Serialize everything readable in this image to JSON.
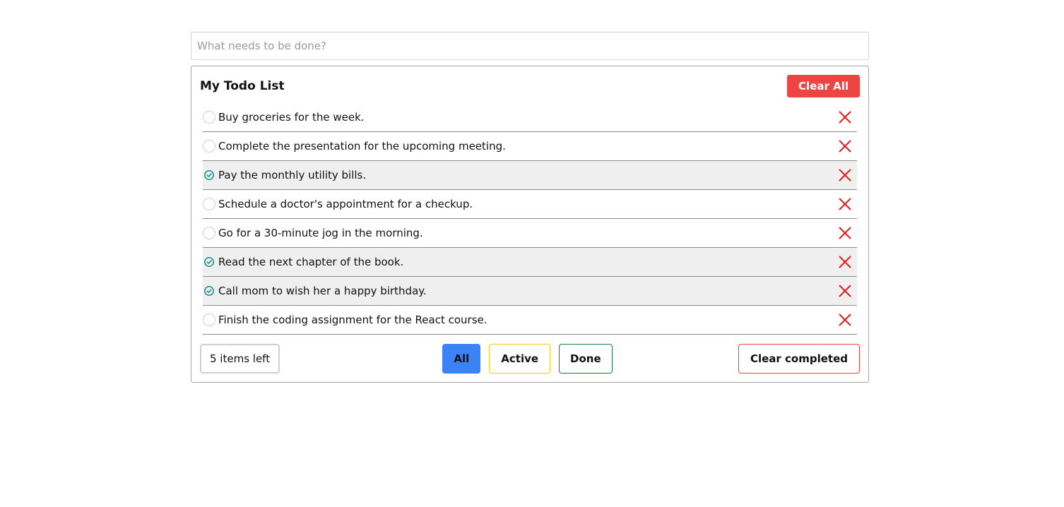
{
  "input": {
    "placeholder": "What needs to be done?",
    "value": ""
  },
  "header": {
    "title": "My Todo List",
    "clear_all_label": "Clear All"
  },
  "todos": [
    {
      "text": "Buy groceries for the week.",
      "done": false
    },
    {
      "text": "Complete the presentation for the upcoming meeting.",
      "done": false
    },
    {
      "text": "Pay the monthly utility bills.",
      "done": true
    },
    {
      "text": "Schedule a doctor's appointment for a checkup.",
      "done": false
    },
    {
      "text": "Go for a 30-minute jog in the morning.",
      "done": false
    },
    {
      "text": "Read the next chapter of the book.",
      "done": true
    },
    {
      "text": "Call mom to wish her a happy birthday.",
      "done": true
    },
    {
      "text": "Finish the coding assignment for the React course.",
      "done": false
    }
  ],
  "footer": {
    "items_left": "5 items left",
    "filters": [
      "All",
      "Active",
      "Done"
    ],
    "selected_filter": "All",
    "clear_completed_label": "Clear completed"
  },
  "icons": {
    "done_check": "check-circle-icon",
    "unchecked": "empty-circle-icon",
    "delete": "close-icon"
  },
  "colors": {
    "danger": "#ef4444",
    "delete_icon": "#e11d1d",
    "filter_all": "#3b82f6",
    "filter_active_border": "#facc15",
    "filter_done_border": "#15803d",
    "check_teal": "#0f8a8a",
    "done_row_bg": "#efefef"
  }
}
